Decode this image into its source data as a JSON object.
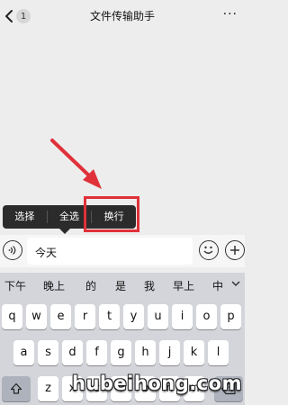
{
  "header": {
    "back_badge": "1",
    "title": "文件传输助手",
    "more": "···"
  },
  "context_menu": {
    "items": [
      "选择",
      "全选",
      "换行"
    ],
    "highlighted": "换行"
  },
  "input": {
    "value": "今天"
  },
  "candidates": [
    "下午",
    "晚上",
    "的",
    "是",
    "我",
    "早上",
    "中"
  ],
  "keyboard": {
    "row1": [
      "q",
      "w",
      "e",
      "r",
      "t",
      "y",
      "u",
      "i",
      "o",
      "p"
    ],
    "row2": [
      "a",
      "s",
      "d",
      "f",
      "g",
      "h",
      "j",
      "k",
      "l"
    ],
    "row3": [
      "z",
      "x",
      "c",
      "v",
      "b",
      "n",
      "m"
    ]
  },
  "watermark": "hubeihong.com",
  "colors": {
    "highlight": "#e0313a",
    "menu_bg": "#2b2b2b"
  }
}
